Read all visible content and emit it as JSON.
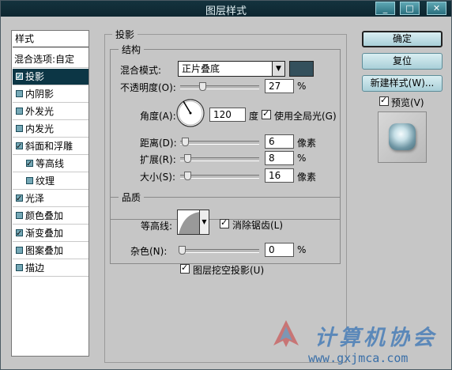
{
  "window": {
    "title": "图层样式"
  },
  "titlebar_buttons": {
    "minimize": "_",
    "maximize": "□",
    "close": "✕"
  },
  "stylelist": {
    "header": "样式",
    "blend": "混合选项:自定",
    "items": [
      {
        "label": "投影",
        "checked": true,
        "selected": true
      },
      {
        "label": "内阴影",
        "checked": false
      },
      {
        "label": "外发光",
        "checked": false
      },
      {
        "label": "内发光",
        "checked": false
      },
      {
        "label": "斜面和浮雕",
        "checked": true
      },
      {
        "label": "等高线",
        "checked": true,
        "indent": true
      },
      {
        "label": "纹理",
        "checked": false,
        "indent": true
      },
      {
        "label": "光泽",
        "checked": true
      },
      {
        "label": "颜色叠加",
        "checked": false
      },
      {
        "label": "渐变叠加",
        "checked": true
      },
      {
        "label": "图案叠加",
        "checked": false
      },
      {
        "label": "描边",
        "checked": false
      }
    ]
  },
  "panel": {
    "title": "投影",
    "structure": {
      "title": "结构",
      "blend_mode_label": "混合模式:",
      "blend_mode_value": "正片叠底",
      "blend_color": "#34505c",
      "opacity_label": "不透明度(O):",
      "opacity_value": "27",
      "opacity_unit": "%",
      "angle_label": "角度(A):",
      "angle_value": "120",
      "angle_unit": "度",
      "global_light_label": "使用全局光(G)",
      "distance_label": "距离(D):",
      "distance_value": "6",
      "distance_unit": "像素",
      "spread_label": "扩展(R):",
      "spread_value": "8",
      "spread_unit": "%",
      "size_label": "大小(S):",
      "size_value": "16",
      "size_unit": "像素"
    },
    "quality": {
      "title": "品质",
      "contour_label": "等高线:",
      "antialias_label": "消除锯齿(L)",
      "noise_label": "杂色(N):",
      "noise_value": "0",
      "noise_unit": "%"
    },
    "knockout_label": "图层挖空投影(U)"
  },
  "buttons": {
    "ok": "确定",
    "reset": "复位",
    "new_style": "新建样式(W)...",
    "preview": "预览(V)"
  },
  "watermark": {
    "text": "计算机协会",
    "url": "www.gxjmca.com"
  }
}
